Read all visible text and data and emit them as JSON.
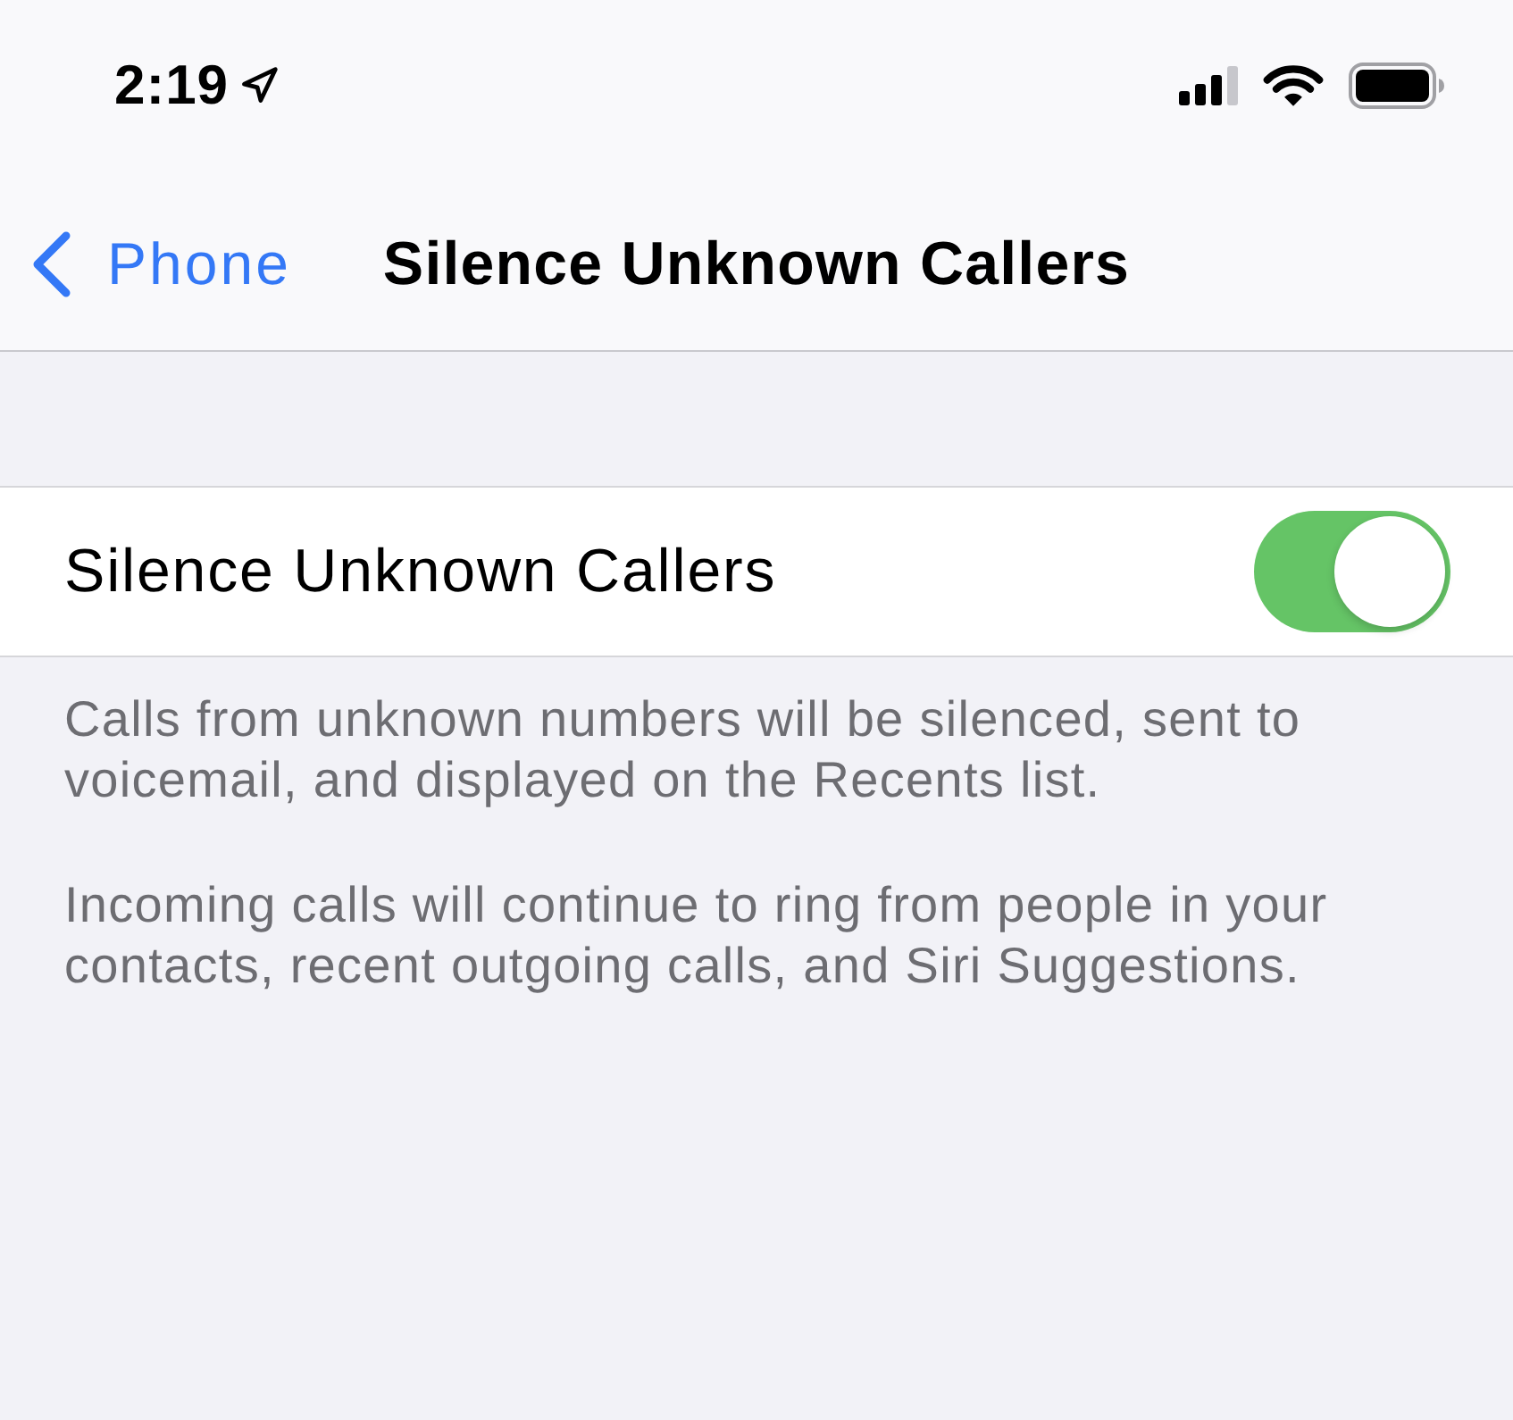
{
  "status_bar": {
    "time": "2:19"
  },
  "nav_bar": {
    "back_label": "Phone",
    "title": "Silence Unknown Callers"
  },
  "settings": [
    {
      "label": "Silence Unknown Callers",
      "on": true
    }
  ],
  "footer": [
    "Calls from unknown numbers will be silenced, sent to voicemail, and displayed on the Recents list.",
    "Incoming calls will continue to ring from people in your contacts, recent outgoing calls, and Siri Suggestions."
  ]
}
